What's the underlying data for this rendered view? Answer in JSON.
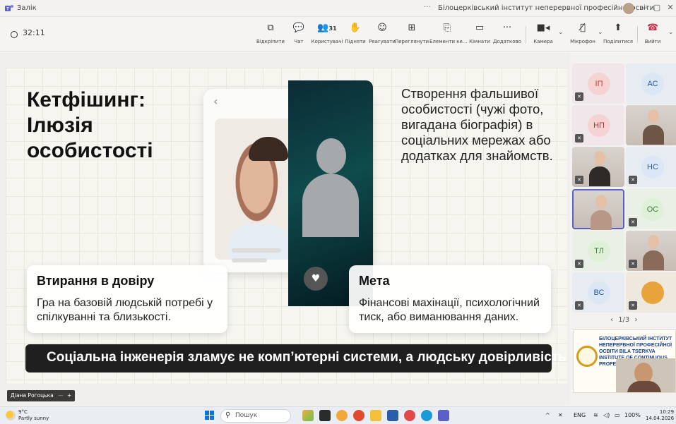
{
  "window": {
    "title": "Залік",
    "organization": "Білоцерківський інститут неперервної професійної освіти",
    "more": "···",
    "controls": {
      "minimize": "—",
      "maximize": "▢",
      "close": "✕"
    }
  },
  "toolbar": {
    "timer": "32:11",
    "buttons": [
      {
        "icon": "open-icon",
        "label": "Відкріпити"
      },
      {
        "icon": "chat-icon",
        "label": "Чат"
      },
      {
        "icon": "people-icon",
        "label": "Користувачі",
        "count": "31"
      },
      {
        "icon": "raise-hand-icon",
        "label": "Підняти"
      },
      {
        "icon": "react-icon",
        "label": "Реагувати"
      },
      {
        "icon": "view-icon",
        "label": "Переглянути"
      },
      {
        "icon": "apps-icon",
        "label": "Елементи ке..."
      },
      {
        "icon": "rooms-icon",
        "label": "Кімнати"
      },
      {
        "icon": "more-icon",
        "label": "Додатково"
      },
      {
        "icon": "camera-icon",
        "label": "Камера"
      },
      {
        "icon": "mic-off-icon",
        "label": "Мікрофон"
      },
      {
        "icon": "share-icon",
        "label": "Поділитися"
      },
      {
        "icon": "leave-icon",
        "label": "Вийти"
      }
    ]
  },
  "slide": {
    "title": "Кетфішинг: Ілюзія особистості",
    "description": "Створення фальшивої особистості (чужі фото, вигадана біографія) в соціальних мережах або додатках для знайомств.",
    "card_left": {
      "title": "Втирання в довіру",
      "body": "Гра на базовій людській потребі у спілкуванні та близькості."
    },
    "card_right": {
      "title": "Мета",
      "body": "Фінансові махінації, психологічний тиск, або виманювання даних."
    },
    "banner": "Соціальна інженерія зламує не комп’ютерні системи, а людську довірливість."
  },
  "presenter_name": "Діана Рогоцька",
  "participants": {
    "tiles": [
      {
        "initials": "ІП",
        "color": "#f6d3d3",
        "text_color": "#b93b3b",
        "video": false
      },
      {
        "initials": "АС",
        "color": "#dbe7f5",
        "text_color": "#2c5a9a",
        "video": false
      },
      {
        "initials": "НП",
        "color": "#f6d3d3",
        "text_color": "#9a3b3b",
        "video": false
      },
      {
        "initials": "",
        "video": true
      },
      {
        "initials": "",
        "video": true
      },
      {
        "initials": "НС",
        "color": "#dbe7f5",
        "text_color": "#2c5a9a",
        "video": false
      },
      {
        "initials": "",
        "video": true,
        "active": true
      },
      {
        "initials": "ОС",
        "color": "#dff0d8",
        "text_color": "#3b7a3b",
        "video": false
      },
      {
        "initials": "ТЛ",
        "color": "#dff0d8",
        "text_color": "#3b7a3b",
        "video": false
      },
      {
        "initials": "",
        "video": true
      },
      {
        "initials": "ВС",
        "color": "#dbe7f5",
        "text_color": "#2c5a9a",
        "video": false
      },
      {
        "initials": "",
        "video": true
      }
    ],
    "pager": "1/3",
    "share_tile": {
      "text": "БІЛОЦЕРКІВСЬКИЙ ІНСТИТУТ НЕПЕРЕРВНОЇ ПРОФЕСІЙНОЇ ОСВІТИ BILA TSERKVA INSTITUTE OF CONTINUOUS PROFESSIONAL EDUCATION"
    }
  },
  "taskbar": {
    "weather_temp": "9°C",
    "weather_desc": "Partly sunny",
    "search_placeholder": "Пошук",
    "lang": "ENG",
    "battery": "100%",
    "time": "10:29",
    "date": "14.04.2026"
  },
  "colors": {
    "accent": "#5b5fc7",
    "leave": "#c4314b"
  }
}
